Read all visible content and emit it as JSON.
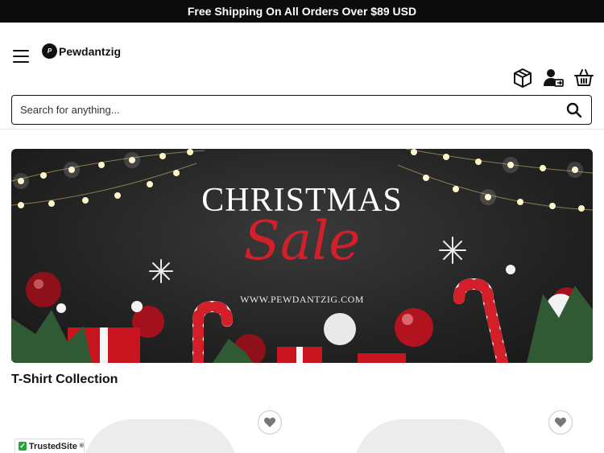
{
  "announcement": "Free Shipping On All Orders Over $89 USD",
  "brand": {
    "name": "Pewdantzig",
    "mark": "P"
  },
  "header": {
    "icons": [
      "menu-icon",
      "package-icon",
      "account-icon",
      "cart-icon"
    ]
  },
  "search": {
    "placeholder": "Search for anything..."
  },
  "banner": {
    "title": "CHRISTMAS",
    "script": "Sale",
    "url": "WWW.PEWDANTZIG.COM"
  },
  "section": {
    "title": "T-Shirt Collection"
  },
  "trust_badge": {
    "label": "TrustedSite",
    "sup": "®"
  },
  "colors": {
    "topbar": "#0b0b0b",
    "accent_red": "#d21f2a",
    "trust_green": "#27a33b"
  }
}
